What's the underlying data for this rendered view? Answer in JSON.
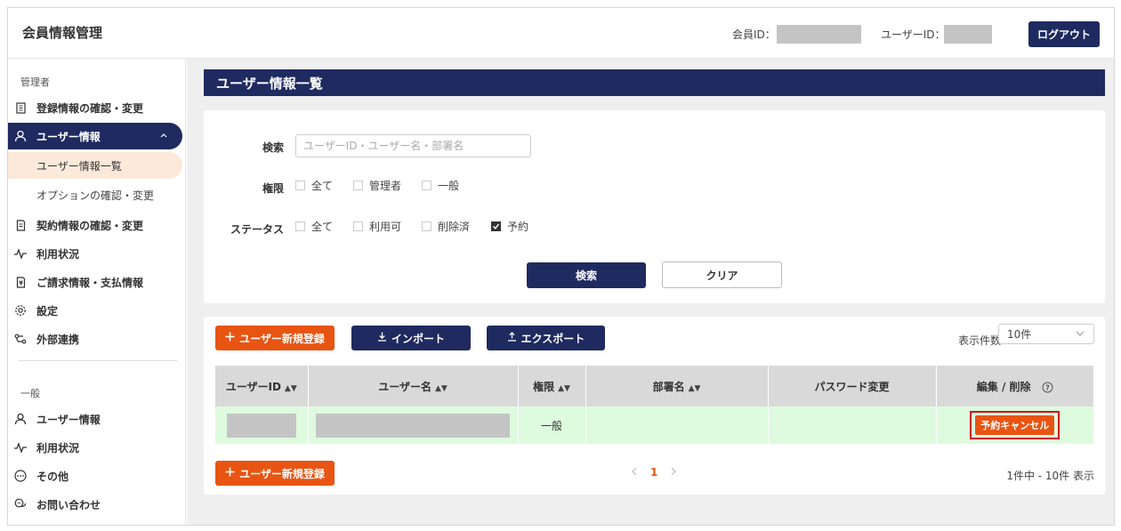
{
  "header": {
    "app_title": "会員情報管理",
    "member_id_label": "会員ID：",
    "user_id_label": "ユーザーID：",
    "logout_label": "ログアウト"
  },
  "sidebar": {
    "admin_section": "管理者",
    "general_section": "一般",
    "admin_items": [
      {
        "label": "登録情報の確認・変更",
        "icon": "building-icon"
      },
      {
        "label": "ユーザー情報",
        "icon": "user-icon"
      },
      {
        "label": "契約情報の確認・変更",
        "icon": "document-icon"
      },
      {
        "label": "利用状況",
        "icon": "activity-icon"
      },
      {
        "label": "ご請求情報・支払情報",
        "icon": "invoice-icon"
      },
      {
        "label": "設定",
        "icon": "gear-icon"
      },
      {
        "label": "外部連携",
        "icon": "link-icon"
      }
    ],
    "user_sub_items": [
      {
        "label": "ユーザー情報一覧"
      },
      {
        "label": "オプションの確認・変更"
      }
    ],
    "general_items": [
      {
        "label": "ユーザー情報",
        "icon": "user-icon"
      },
      {
        "label": "利用状況",
        "icon": "activity-icon"
      },
      {
        "label": "その他",
        "icon": "more-icon"
      },
      {
        "label": "お問い合わせ",
        "icon": "chat-icon"
      }
    ]
  },
  "page": {
    "title": "ユーザー情報一覧"
  },
  "search": {
    "search_label": "検索",
    "search_placeholder": "ユーザーID・ユーザー名・部署名",
    "role_label": "権限",
    "role_options": [
      {
        "label": "全て",
        "checked": false
      },
      {
        "label": "管理者",
        "checked": false
      },
      {
        "label": "一般",
        "checked": false
      }
    ],
    "status_label": "ステータス",
    "status_options": [
      {
        "label": "全て",
        "checked": false
      },
      {
        "label": "利用可",
        "checked": false
      },
      {
        "label": "削除済",
        "checked": false
      },
      {
        "label": "予約",
        "checked": true
      }
    ],
    "search_button": "検索",
    "clear_button": "クリア"
  },
  "list": {
    "new_user_button": "ユーザー新規登録",
    "import_button": "インポート",
    "export_button": "エクスポート",
    "per_page_label": "表示件数",
    "per_page_value": "10件",
    "columns": [
      "ユーザーID",
      "ユーザー名",
      "権限",
      "部署名",
      "パスワード変更",
      "編集 / 削除"
    ],
    "rows": [
      {
        "role": "一般",
        "action": "予約キャンセル"
      }
    ],
    "pager_current": "1",
    "range_text": "1件中 - 10件 表示"
  },
  "colors": {
    "navy": "#1f2a60",
    "orange": "#e85412",
    "row_green": "#dffbdf",
    "highlight_red": "#d01010"
  }
}
